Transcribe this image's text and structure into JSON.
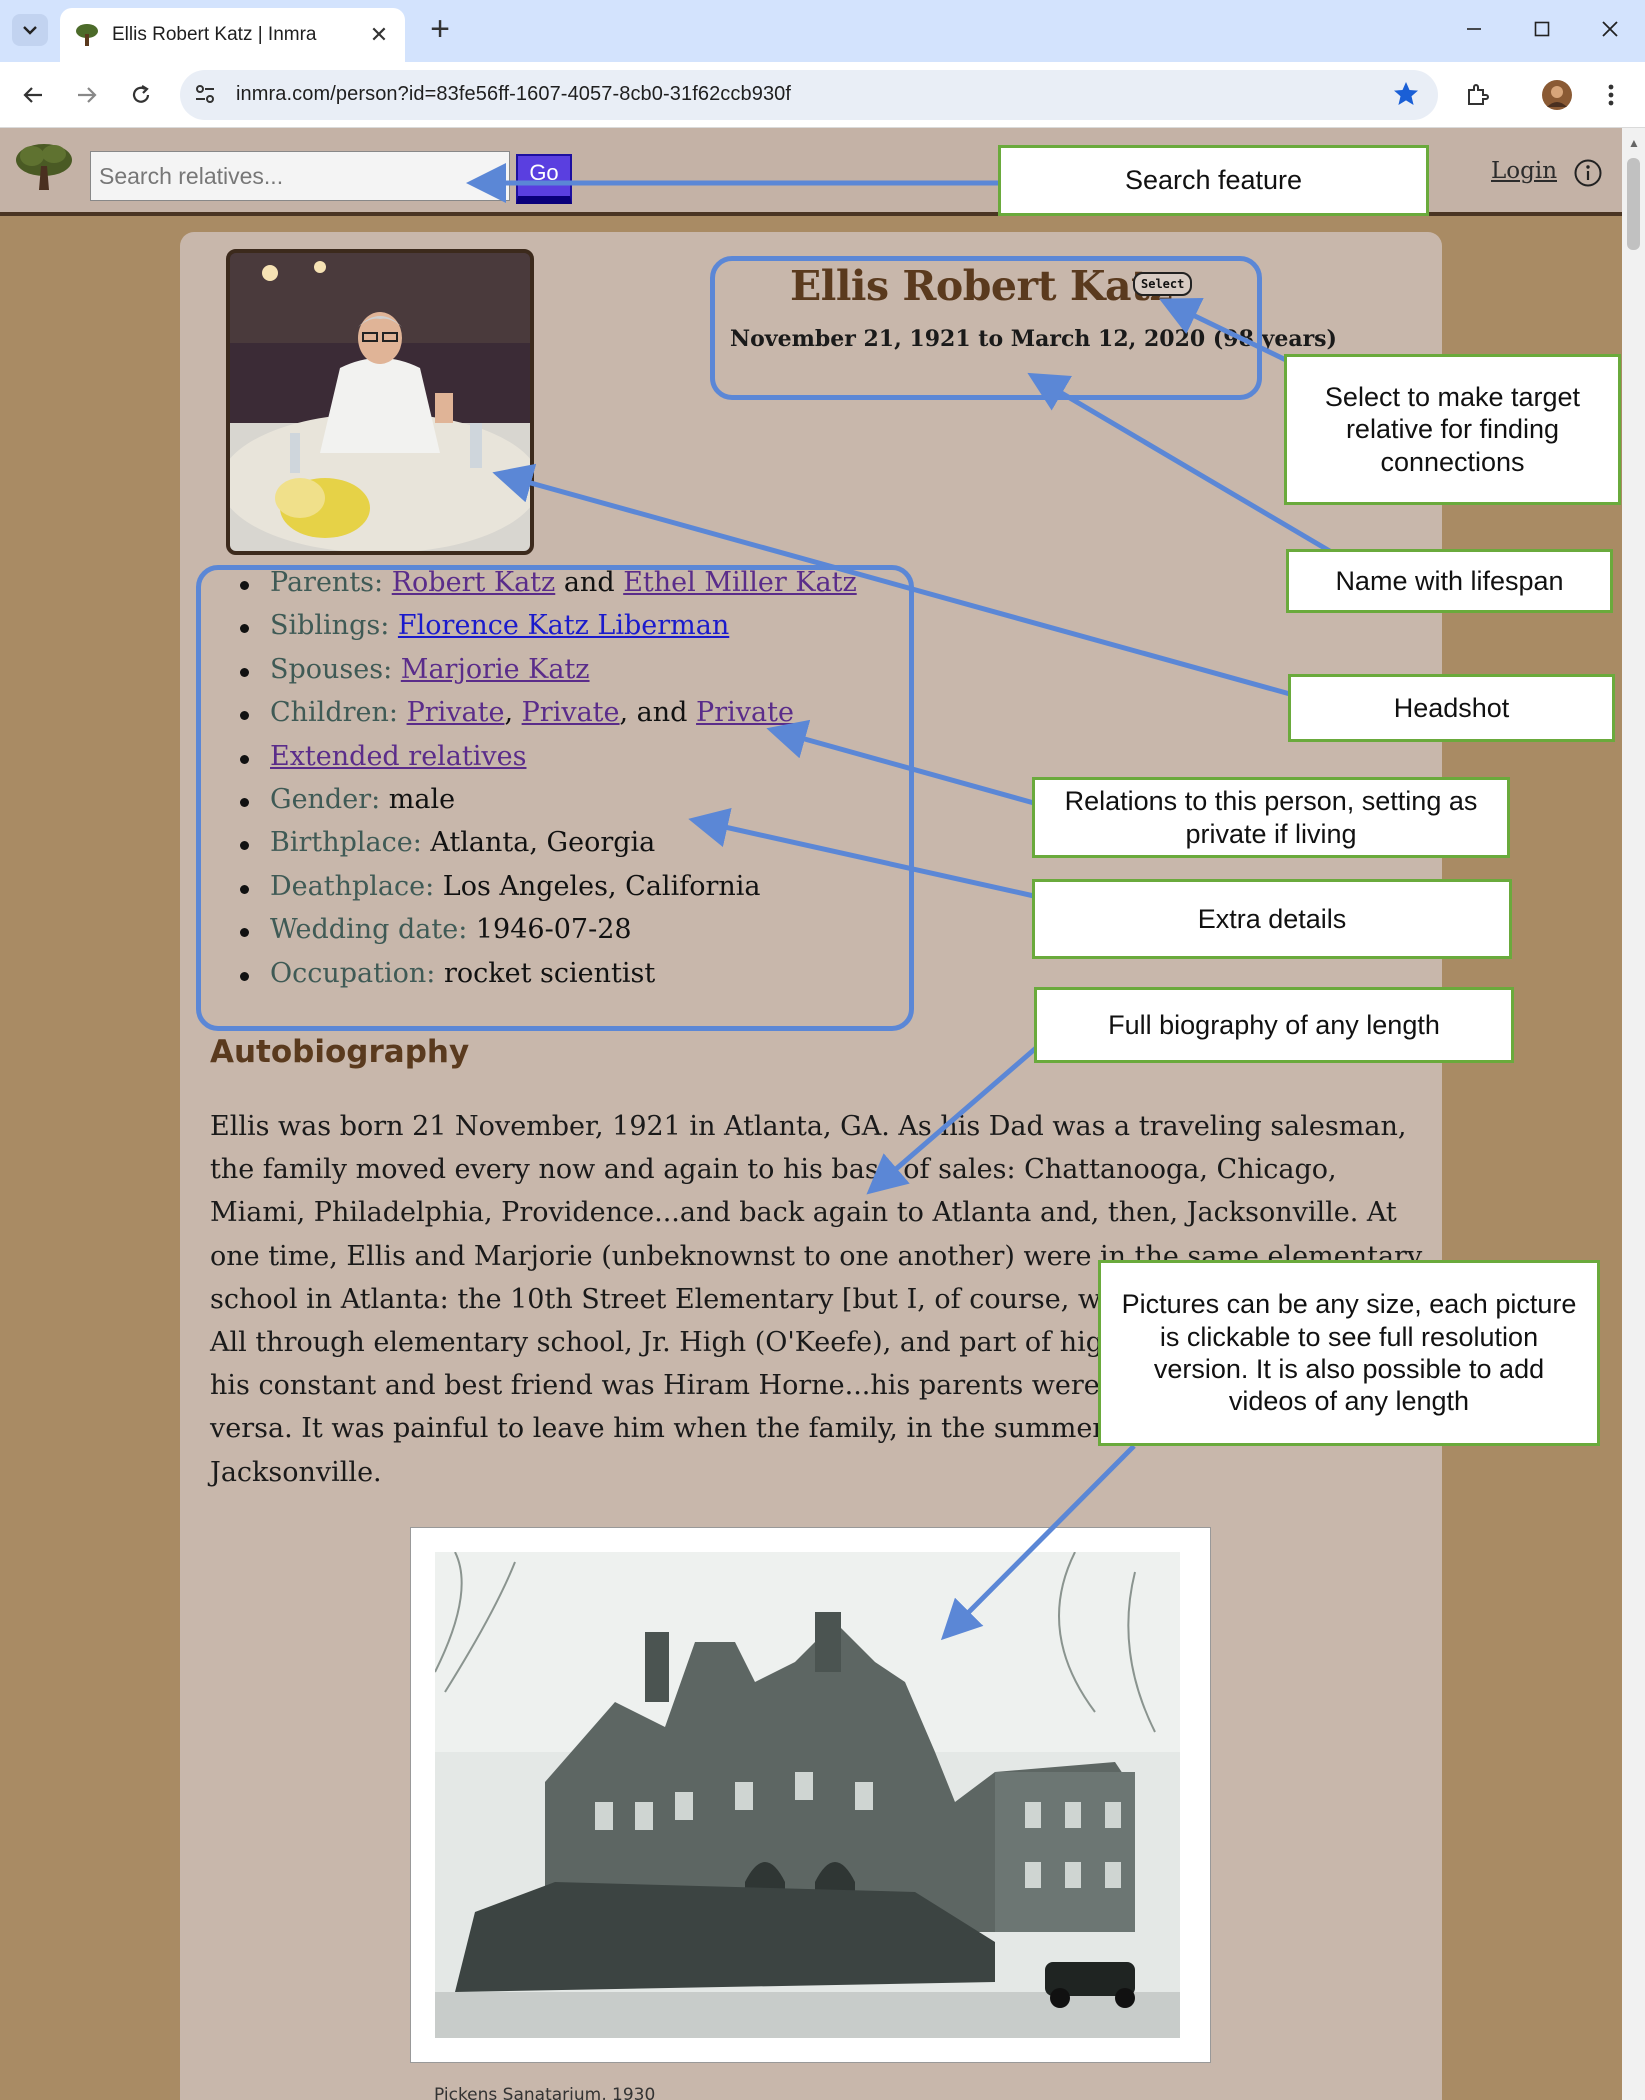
{
  "browser": {
    "tab_title": "Ellis Robert Katz | Inmra",
    "url": "inmra.com/person?id=83fe56ff-1607-4057-8cb0-31f62ccb930f",
    "tab_close": "✕",
    "new_tab": "+"
  },
  "header": {
    "search_placeholder": "Search relatives...",
    "go_label": "Go",
    "login_label": "Login"
  },
  "person": {
    "name": "Ellis Robert Katz",
    "select_label": "Select",
    "lifespan": "November 21, 1921 to March 12, 2020 (98 years)"
  },
  "facts": {
    "parents_label": "Parents: ",
    "parent1": "Robert Katz",
    "and": " and ",
    "parent2": "Ethel Miller Katz",
    "siblings_label": "Siblings: ",
    "sibling1": "Florence Katz Liberman",
    "spouses_label": "Spouses: ",
    "spouse1": "Marjorie Katz",
    "children_label": "Children: ",
    "child1": "Private",
    "comma": ", ",
    "child2": "Private",
    "comma_and": ", and ",
    "child3": "Private",
    "extended": "Extended relatives",
    "gender_label": "Gender: ",
    "gender": "male",
    "birthplace_label": "Birthplace: ",
    "birthplace": "Atlanta, Georgia",
    "deathplace_label": "Deathplace: ",
    "deathplace": "Los Angeles, California",
    "wedding_label": "Wedding date: ",
    "wedding": "1946-07-28",
    "occupation_label": "Occupation: ",
    "occupation": "rocket scientist"
  },
  "bio": {
    "heading": "Autobiography",
    "lines": [
      "Ellis was born 21 November, 1921 in Atlanta, GA. As his Dad was a traveling salesman,",
      "the family moved every now and again to his base of sales: Chattanooga, Chicago,",
      "Miami, Philadelphia, Providence...and back again to Atlanta and, then, Jacksonville. At",
      "one time, Ellis and Marjorie (unbeknownst to one another) were in the same elementary",
      "school in Atlanta: the 10th Street Elementary [but I, of course, was",
      "All through elementary school, Jr. High (O'Keefe), and part of high",
      "his constant and best friend was Hiram Horne...his parents were l",
      "versa. It was painful to leave him when the family, in the summer",
      "Jacksonville."
    ],
    "caption": "Pickens Sanatarium, 1930"
  },
  "annotations": {
    "search_feature": "Search feature",
    "select_target": "Select to make target relative for finding connections",
    "name_lifespan": "Name with lifespan",
    "headshot": "Headshot",
    "relations": "Relations to this person, setting as private if living",
    "extra_details": "Extra details",
    "full_bio": "Full biography of any length",
    "pictures": "Pictures can be any size, each picture is clickable to see full resolution version.  It is also possible to add videos of any length"
  },
  "colors": {
    "annotation_blue": "#5b87d6",
    "annotation_green_border": "#6aaa3c",
    "heading_brown": "#5a3a1e",
    "link_purple": "#5a2c8a",
    "link_blue": "#1a1acc",
    "go_button": "#5a3fe0"
  }
}
